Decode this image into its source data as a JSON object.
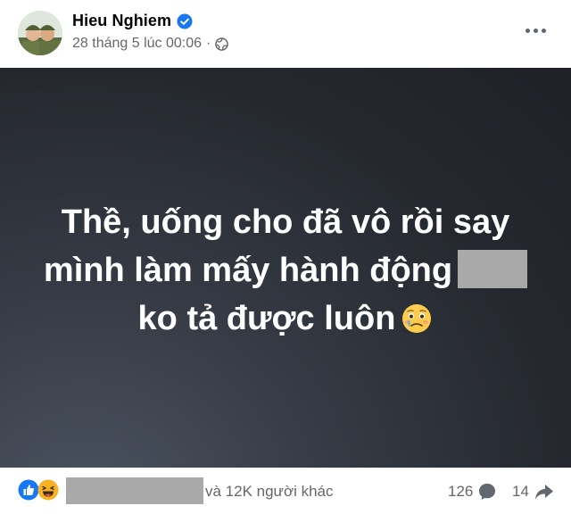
{
  "post": {
    "author": "Hieu Nghiem",
    "timestamp": "28 tháng 5 lúc 00:06",
    "separator": "·",
    "privacy_icon": "globe-icon",
    "verified_icon": "verified-badge-icon",
    "more_icon": "more-options-icon"
  },
  "content": {
    "line1": "Thề, uống cho đã vô rồi say",
    "line2": "mình làm mấy hành động",
    "line3": "ko tả được luôn",
    "emoji": "face-holding-back-tears-icon"
  },
  "footer": {
    "others_text": "và 12K người khác",
    "comment_count": "126",
    "share_count": "14"
  },
  "colors": {
    "verified": "#1877f2",
    "like": "#1877f2",
    "haha": "#f7b125",
    "meta_text": "#65676b",
    "redaction": "#a9a9a9"
  }
}
